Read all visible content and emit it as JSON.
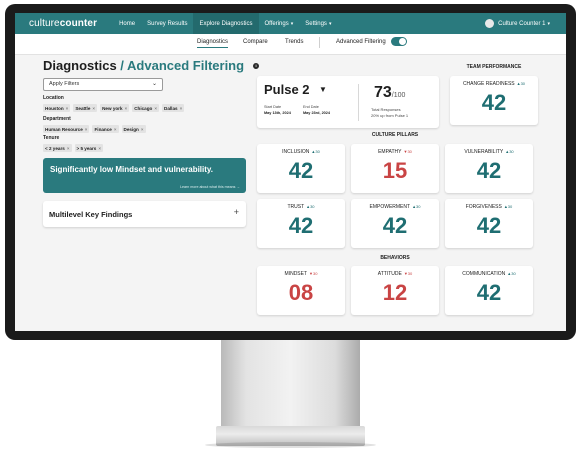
{
  "navbar": {
    "logo_main": "culture",
    "logo_accent": "counter",
    "items": [
      {
        "label": "Home"
      },
      {
        "label": "Survey Results"
      },
      {
        "label": "Explore Diagnostics"
      },
      {
        "label": "Offerings",
        "caret": "▾"
      },
      {
        "label": "Settings",
        "caret": "▾"
      }
    ],
    "user": "Culture Counter 1",
    "user_caret": "▾"
  },
  "subnav": {
    "tabs": [
      {
        "label": "Diagnostics"
      },
      {
        "label": "Compare"
      },
      {
        "label": "Trends"
      }
    ],
    "toggle_label": "Advanced Filtering",
    "toggle_on": true
  },
  "page": {
    "title": "Diagnostics",
    "title_sep": " / ",
    "title_accent": "Advanced Filtering",
    "info_glyph": "i"
  },
  "filters": {
    "select_label": "Apply Filters",
    "groups": [
      {
        "label": "Location",
        "chips": [
          "Houston",
          "Seattle",
          "New york",
          "Chicago",
          "Dallas"
        ]
      },
      {
        "label": "Department",
        "chips": [
          "Human Resource",
          "Finance",
          "Design"
        ]
      },
      {
        "label": "Tenure",
        "chips": [
          "< 2 years",
          "> 5 years"
        ]
      }
    ],
    "chip_remove": "×"
  },
  "insight": {
    "text": "Significantly low Mindset and vulnerability.",
    "link": "Learn more about what this means →"
  },
  "findings": {
    "title": "Multilevel Key Findings",
    "expand": "+"
  },
  "pulse": {
    "title": "Pulse 2",
    "caret": "▼",
    "start_label": "Start Date",
    "start_value": "May 13th, 2024",
    "end_label": "End Date",
    "end_value": "May 23rd, 2024",
    "score": "73",
    "score_max": "/100",
    "responses_label": "Total Responses",
    "responses_delta": "20% up from Pulse 1"
  },
  "sections": {
    "team_performance": "TEAM PERFORMANCE",
    "culture_pillars": "CULTURE PILLARS",
    "behaviors": "BEHAVIORS"
  },
  "metrics": {
    "change_readiness": {
      "label": "CHANGE READINESS",
      "trend": "▲30",
      "value": "42"
    },
    "inclusion": {
      "label": "INCLUSION",
      "trend": "▲30",
      "value": "42"
    },
    "empathy": {
      "label": "EMPATHY",
      "trend": "▼30",
      "value": "15"
    },
    "vulnerability": {
      "label": "VULNERABILITY",
      "trend": "▲30",
      "value": "42"
    },
    "trust": {
      "label": "TRUST",
      "trend": "▲30",
      "value": "42"
    },
    "empowerment": {
      "label": "EMPOWERMENT",
      "trend": "▲30",
      "value": "42"
    },
    "forgiveness": {
      "label": "FORGIVENESS",
      "trend": "▲30",
      "value": "42"
    },
    "mindset": {
      "label": "MINDSET",
      "trend": "▼30",
      "value": "08"
    },
    "attitude": {
      "label": "ATTITUDE",
      "trend": "▼30",
      "value": "12"
    },
    "communication": {
      "label": "COMMUNICATION",
      "trend": "▲30",
      "value": "42"
    }
  },
  "colors": {
    "accent": "#2a7a7e",
    "positive": "#1f6e72",
    "negative": "#c94444"
  }
}
